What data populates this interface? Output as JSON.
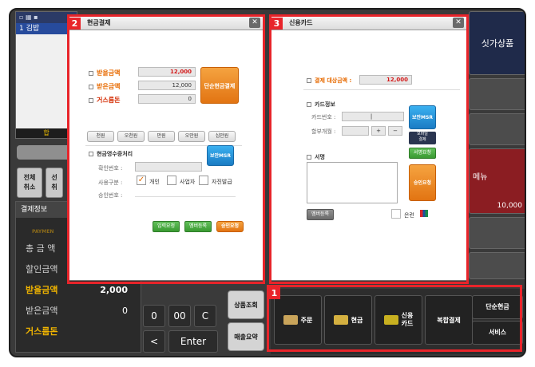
{
  "background": {
    "order_header": "▫  ▦ ▪",
    "order_row": "1  김밥",
    "order_footer": "합",
    "side_buttons": [
      {
        "label": "전체\n취소"
      },
      {
        "label": "선\n취"
      }
    ],
    "payment_panel": {
      "tab": "결제정보",
      "brand": "PAYMEN",
      "rows": [
        {
          "label": "총 금 액",
          "value": ""
        },
        {
          "label": "할인금액",
          "value": ""
        },
        {
          "label": "받을금액",
          "value": "2,000"
        },
        {
          "label": "받은금액",
          "value": "0"
        },
        {
          "label": "거스름돈",
          "value": ""
        }
      ]
    },
    "numpad": {
      "zero": "0",
      "double_zero": "00",
      "clear": "C",
      "back": "<",
      "enter": "Enter"
    },
    "side_actions": {
      "product_lookup": "상품조회",
      "sales_request": "매출요약"
    },
    "right_panel": {
      "top_label": "싯가상품",
      "menu_label": "메뉴",
      "menu_price": "10,000"
    },
    "function_bar": {
      "order": "주문",
      "cash": "현금",
      "credit_card": "신용\n카드",
      "mixed_payment": "복합결제",
      "simple_cash": "단순현금",
      "service": "서비스"
    }
  },
  "highlights": {
    "box1": "1",
    "box2": "2",
    "box3": "3"
  },
  "cash_dialog": {
    "title": "현금결제",
    "receive_label": "받을금액",
    "receive_value": "12,000",
    "received_label": "받은금액",
    "received_value": "12,000",
    "change_label": "거스름돈",
    "change_value": "0",
    "simple_cash_button": "단순현금결제",
    "quick_amounts": [
      "천원",
      "오천원",
      "만원",
      "오만원",
      "십만원"
    ],
    "receipt_title": "현금영수증처리",
    "confirm_number_label": "확인번호 :",
    "use_type_label": "사용구분 :",
    "personal": "개인",
    "business": "사업자",
    "self_issue": "자진발급",
    "approval_label": "승인번호 :",
    "msr_button": "보안MSR",
    "request_input": "입력요청",
    "membership": "멤버등록",
    "approve": "승인요청"
  },
  "card_dialog": {
    "title": "신용카드",
    "amount_label": "결제 대상금액 :",
    "amount_value": "12,000",
    "card_info_title": "카드정보",
    "card_number_label": "카드번호 :",
    "card_number_value": "|",
    "installment_label": "할부개월 :",
    "plus": "+",
    "minus": "−",
    "msr_button": "보안MSR",
    "mobile_pay": "모바일\n결제",
    "sign_title": "서명",
    "sign_request": "서명요청",
    "approve": "승인요청",
    "membership": "멤버등록",
    "all_label": "은련"
  },
  "colors": {
    "highlight": "#e8242a",
    "orange": "#e27412",
    "blue": "#1b7cc4",
    "green": "#3a9a32"
  }
}
